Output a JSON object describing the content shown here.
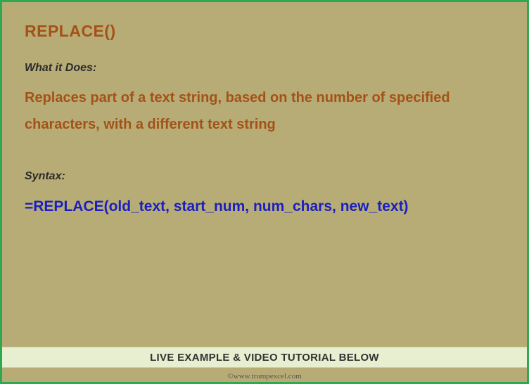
{
  "title": "REPLACE()",
  "sections": {
    "what_label": "What it Does:",
    "description": "Replaces part of a text string, based on the number of specified characters, with a different text string",
    "syntax_label": "Syntax:",
    "syntax_text": "=REPLACE(old_text, start_num, num_chars, new_text)"
  },
  "footer": "LIVE EXAMPLE & VIDEO TUTORIAL BELOW",
  "attribution": "©www.trumpexcel.com"
}
